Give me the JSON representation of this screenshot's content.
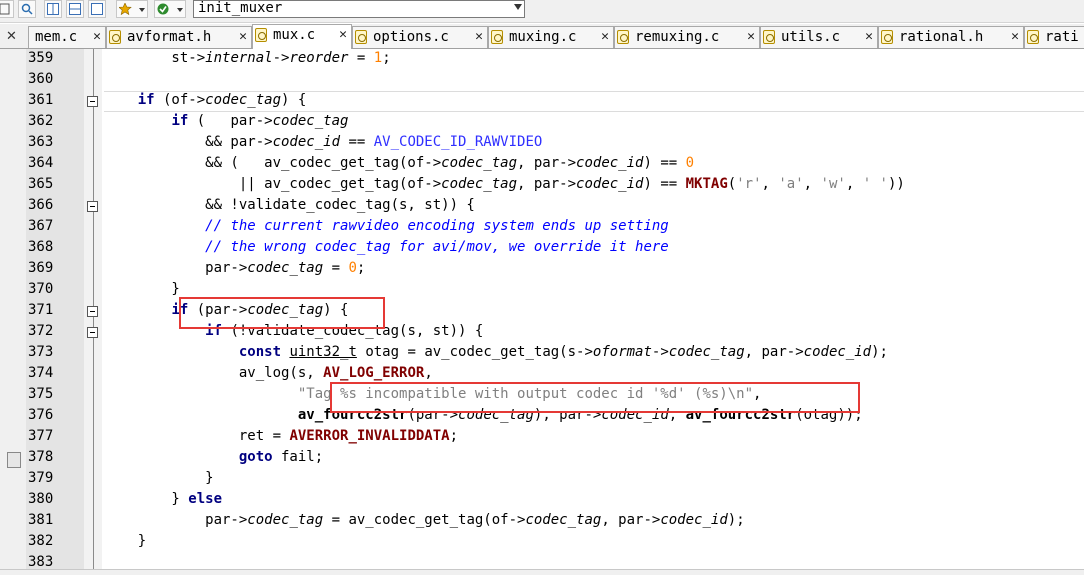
{
  "toolbar": {
    "function_combo": "init_muxer"
  },
  "tabs": [
    {
      "label": "mem.c",
      "icon": "file-icon",
      "active": false
    },
    {
      "label": "avformat.h",
      "icon": "file-icon",
      "active": false
    },
    {
      "label": "mux.c",
      "icon": "file-icon",
      "active": true
    },
    {
      "label": "options.c",
      "icon": "file-icon",
      "active": false
    },
    {
      "label": "muxing.c",
      "icon": "file-icon",
      "active": false
    },
    {
      "label": "remuxing.c",
      "icon": "file-icon",
      "active": false
    },
    {
      "label": "utils.c",
      "icon": "file-icon",
      "active": false
    },
    {
      "label": "rational.h",
      "icon": "file-icon",
      "active": false
    },
    {
      "label": "rati",
      "icon": "file-icon",
      "active": false
    }
  ],
  "lines": [
    {
      "n": "359",
      "t": "        st->internal->reorder = 1;"
    },
    {
      "n": "360",
      "t": ""
    },
    {
      "n": "361",
      "t": "    if (of->codec_tag) {"
    },
    {
      "n": "362",
      "t": "        if (   par->codec_tag"
    },
    {
      "n": "363",
      "t": "            && par->codec_id == AV_CODEC_ID_RAWVIDEO"
    },
    {
      "n": "364",
      "t": "            && (   av_codec_get_tag(of->codec_tag, par->codec_id) == 0"
    },
    {
      "n": "365",
      "t": "                || av_codec_get_tag(of->codec_tag, par->codec_id) == MKTAG('r', 'a', 'w', ' '))"
    },
    {
      "n": "366",
      "t": "            && !validate_codec_tag(s, st)) {"
    },
    {
      "n": "367",
      "t": "            // the current rawvideo encoding system ends up setting"
    },
    {
      "n": "368",
      "t": "            // the wrong codec_tag for avi/mov, we override it here"
    },
    {
      "n": "369",
      "t": "            par->codec_tag = 0;"
    },
    {
      "n": "370",
      "t": "        }"
    },
    {
      "n": "371",
      "t": "        if (par->codec_tag) {"
    },
    {
      "n": "372",
      "t": "            if (!validate_codec_tag(s, st)) {"
    },
    {
      "n": "373",
      "t": "                const uint32_t otag = av_codec_get_tag(s->oformat->codec_tag, par->codec_id);"
    },
    {
      "n": "374",
      "t": "                av_log(s, AV_LOG_ERROR,"
    },
    {
      "n": "375",
      "t": "                       \"Tag %s incompatible with output codec id '%d' (%s)\\n\","
    },
    {
      "n": "376",
      "t": "                       av_fourcc2str(par->codec_tag), par->codec_id, av_fourcc2str(otag));"
    },
    {
      "n": "377",
      "t": "                ret = AVERROR_INVALIDDATA;"
    },
    {
      "n": "378",
      "t": "                goto fail;"
    },
    {
      "n": "379",
      "t": "            }"
    },
    {
      "n": "380",
      "t": "        } else"
    },
    {
      "n": "381",
      "t": "            par->codec_tag = av_codec_get_tag(of->codec_tag, par->codec_id);"
    },
    {
      "n": "382",
      "t": "    }"
    },
    {
      "n": "383",
      "t": ""
    }
  ],
  "colors": {
    "annotation_box": "#e53935",
    "keyword": "#000080",
    "comment": "#0000ff",
    "number": "#ff8000"
  }
}
